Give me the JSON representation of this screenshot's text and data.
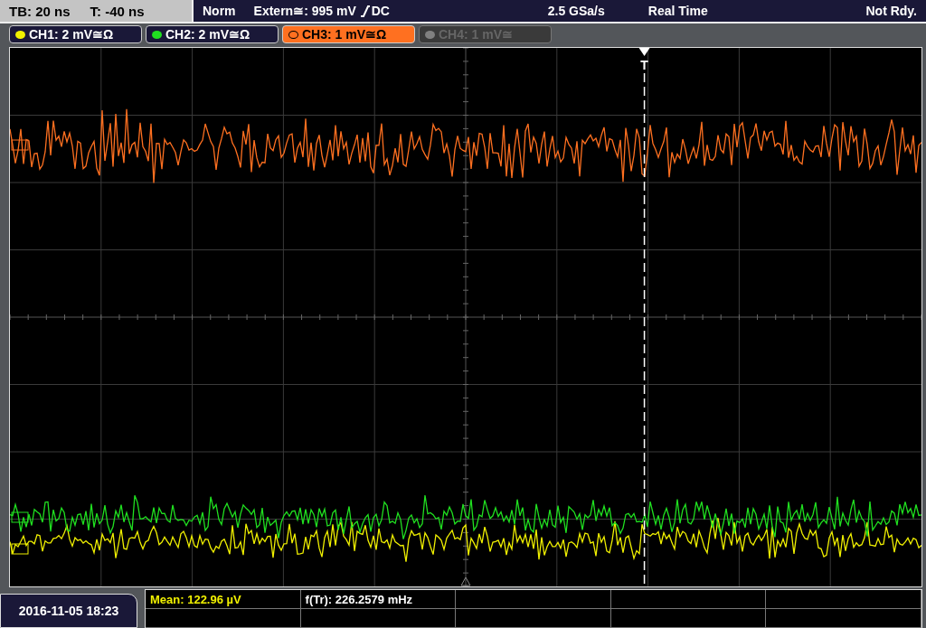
{
  "status_bar": {
    "timebase": "TB: 20 ns",
    "trigger_time": "T: -40 ns",
    "trigger_mode": "Norm",
    "trigger_source": "Extern≅: 995 mV",
    "trigger_coupling": "DC",
    "sample_rate": "2.5 GSa/s",
    "acquisition": "Real Time",
    "state": "Not Rdy."
  },
  "channels": [
    {
      "label": "CH1: 2 mV≅Ω",
      "color": "#f0f000",
      "selected": false,
      "enabled": true
    },
    {
      "label": "CH2: 2 mV≅Ω",
      "color": "#20e020",
      "selected": false,
      "enabled": true
    },
    {
      "label": "CH3: 1 mV≅Ω",
      "color": "#ff7020",
      "selected": true,
      "enabled": true
    },
    {
      "label": "CH4: 1 mV≅",
      "color": "#808080",
      "selected": false,
      "enabled": false
    }
  ],
  "trigger_marker": "T",
  "date": "2016-11-05 18:23",
  "measurements": [
    {
      "text": "Mean: 122.96 µV",
      "color": "#f0f000"
    },
    {
      "text": "f(Tr): 226.2579 mHz",
      "color": "#ffffff"
    }
  ]
}
